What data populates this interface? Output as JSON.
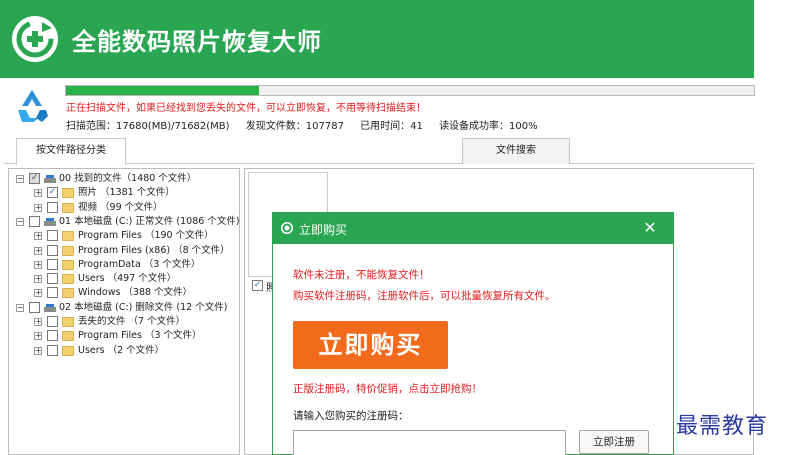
{
  "app": {
    "title": "全能数码照片恢复大师"
  },
  "scan": {
    "progress": 0.28,
    "message": "正在扫描文件，如果已经找到您丢失的文件，可以立即恢复，不用等待扫描结束！",
    "range": "扫描范围：17680(MB)/71682(MB)",
    "found": "发现文件数：107787",
    "elapsed": "已用时间：41",
    "read_rate": "读设备成功率：100%"
  },
  "tabs": {
    "path_label": "按文件路径分类",
    "search_label": "文件搜索"
  },
  "tree": [
    {
      "level": 0,
      "expander": "−",
      "checkbox": "✓",
      "icon": "drive",
      "label": "00 找到的文件（1480 个文件）"
    },
    {
      "level": 1,
      "expander": "+",
      "checkbox": "✓",
      "icon": "folder",
      "label": "照片  （1381 个文件）"
    },
    {
      "level": 1,
      "expander": "+",
      "checkbox": "",
      "icon": "folder",
      "label": "视频  （99 个文件）"
    },
    {
      "level": 0,
      "expander": "−",
      "checkbox": "",
      "icon": "drive",
      "label": "01 本地磁盘 (C:) 正常文件 (1086 个文件)"
    },
    {
      "level": 1,
      "expander": "+",
      "checkbox": "",
      "icon": "folder",
      "label": "Program Files  （190 个文件）"
    },
    {
      "level": 1,
      "expander": "+",
      "checkbox": "",
      "icon": "folder",
      "label": "Program Files (x86)  （8 个文件）"
    },
    {
      "level": 1,
      "expander": "+",
      "checkbox": "",
      "icon": "folder",
      "label": "ProgramData  （3 个文件）"
    },
    {
      "level": 1,
      "expander": "+",
      "checkbox": "",
      "icon": "folder",
      "label": "Users  （497 个文件）"
    },
    {
      "level": 1,
      "expander": "+",
      "checkbox": "",
      "icon": "folder",
      "label": "Windows  （388 个文件）"
    },
    {
      "level": 0,
      "expander": "−",
      "checkbox": "",
      "icon": "drive",
      "label": "02 本地磁盘 (C:) 删除文件 (12 个文件)"
    },
    {
      "level": 1,
      "expander": "+",
      "checkbox": "",
      "icon": "folder",
      "label": "丢失的文件  （7 个文件）"
    },
    {
      "level": 1,
      "expander": "+",
      "checkbox": "",
      "icon": "folder",
      "label": "Program Files  （3 个文件）"
    },
    {
      "level": 1,
      "expander": "+",
      "checkbox": "",
      "icon": "folder",
      "label": "Users  （2 个文件）"
    }
  ],
  "preview": {
    "thumb_checkbox": "✓",
    "thumb_label": "照"
  },
  "dialog": {
    "title": "立即购买",
    "close_glyph": "✕",
    "line1": "软件未注册，不能恢复文件！",
    "line2": "购买软件注册码，注册软件后，可以批量恢复所有文件。",
    "buy_button": "立即购买",
    "promo": "正版注册码，特价促销，点击立即抢购！",
    "reg_label": "请输入您购买的注册码：",
    "reg_value": "",
    "reg_button": "立即注册"
  },
  "watermark": "最需教育",
  "colors": {
    "brand_green": "#2aa652",
    "accent_orange": "#f26a1b",
    "warning_red": "#e31b1b",
    "progress_green": "#27b24a"
  }
}
